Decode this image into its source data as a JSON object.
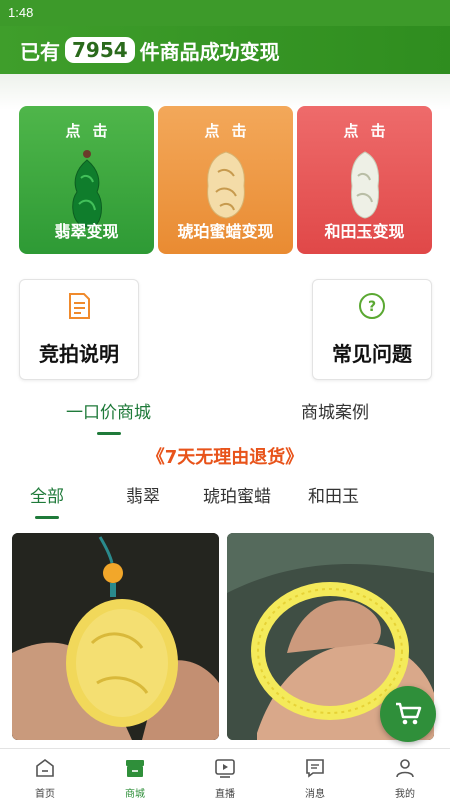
{
  "status_bar": {
    "time": "1:48"
  },
  "hero": {
    "prefix": "已有",
    "count": "7954",
    "suffix": "件商品成功变现"
  },
  "category_cards": [
    {
      "tap": "点击",
      "label": "翡翠变现"
    },
    {
      "tap": "点击",
      "label": "琥珀蜜蜡变现"
    },
    {
      "tap": "点击",
      "label": "和田玉变现"
    }
  ],
  "info_cards": {
    "auction_label": "竞拍说明",
    "faq_label": "常见问题"
  },
  "main_tabs": [
    {
      "label": "一口价商城"
    },
    {
      "label": "商城案例"
    }
  ],
  "promo_text": "《7天无理由退货》",
  "category_tabs": [
    {
      "label": "全部"
    },
    {
      "label": "翡翠"
    },
    {
      "label": "琥珀蜜蜡"
    },
    {
      "label": "和田玉"
    }
  ],
  "bottom_nav": [
    {
      "label": "首页",
      "icon": "home-icon"
    },
    {
      "label": "商城",
      "icon": "shop-icon"
    },
    {
      "label": "直播",
      "icon": "live-icon"
    },
    {
      "label": "消息",
      "icon": "message-icon"
    },
    {
      "label": "我的",
      "icon": "profile-icon"
    }
  ],
  "colors": {
    "brand_green": "#2f8d1f",
    "active_green": "#1f7a3a",
    "promo_orange": "#e8531a",
    "jade_card": "#3aa83e",
    "amber_card": "#ee9a45",
    "hetian_card": "#e45656"
  }
}
